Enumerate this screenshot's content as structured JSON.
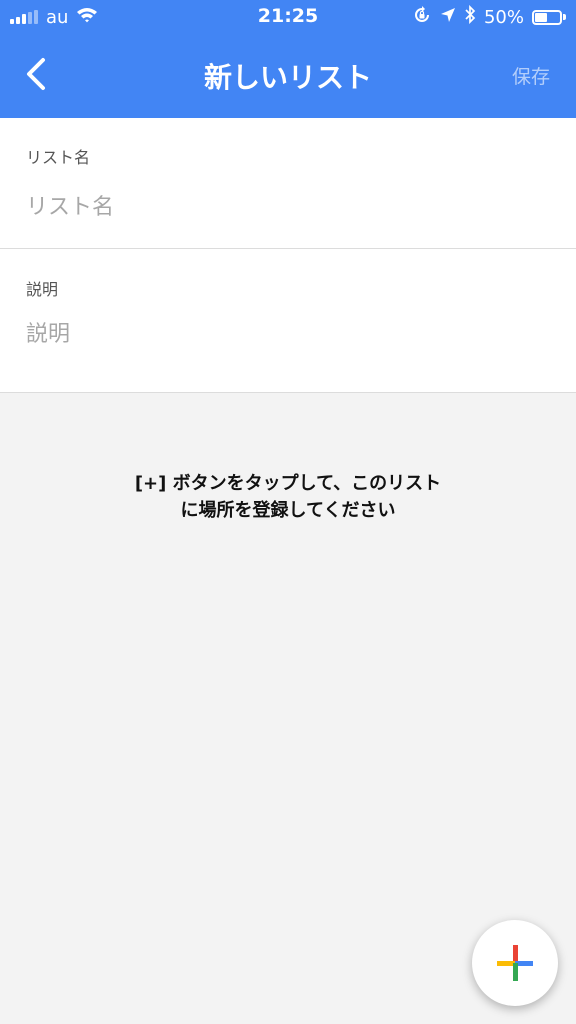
{
  "status_bar": {
    "carrier": "au",
    "time": "21:25",
    "battery_percent": "50%",
    "battery_level": 0.5,
    "icons": [
      "signal-icon",
      "wifi-icon",
      "orientation-lock-icon",
      "location-arrow-icon",
      "bluetooth-icon",
      "battery-icon"
    ]
  },
  "app_bar": {
    "title": "新しいリスト",
    "save_label": "保存",
    "back_icon": "chevron-left-icon",
    "background_color": "#4285f4"
  },
  "form": {
    "name_field": {
      "label": "リスト名",
      "placeholder": "リスト名",
      "value": ""
    },
    "description_field": {
      "label": "説明",
      "placeholder": "説明",
      "value": ""
    }
  },
  "empty_state": {
    "line1": "[+] ボタンをタップして、このリスト",
    "line2": "に場所を登録してください"
  },
  "fab": {
    "icon": "google-plus-icon",
    "colors": [
      "#ea4335",
      "#4285f4",
      "#fbbc05",
      "#34a853"
    ]
  }
}
